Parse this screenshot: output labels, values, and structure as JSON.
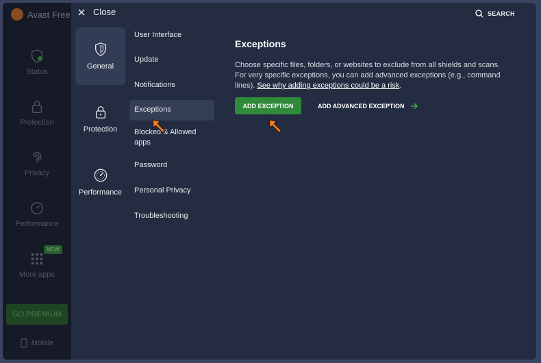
{
  "background_app": {
    "title": "Avast Free A",
    "nav": [
      {
        "label": "Status",
        "icon": "shield-check-icon"
      },
      {
        "label": "Protection",
        "icon": "lock-icon"
      },
      {
        "label": "Privacy",
        "icon": "fingerprint-icon"
      },
      {
        "label": "Performance",
        "icon": "speedometer-icon"
      },
      {
        "label": "More apps",
        "icon": "grid-icon",
        "badge": "NEW"
      }
    ],
    "premium_label": "GO PREMIUM",
    "mobile_label": "Mobile"
  },
  "header": {
    "close_label": "Close",
    "search_label": "SEARCH"
  },
  "categories": [
    {
      "label": "General",
      "icon": "shield-icon",
      "active": true
    },
    {
      "label": "Protection",
      "icon": "lock-icon",
      "active": false
    },
    {
      "label": "Performance",
      "icon": "speedometer-icon",
      "active": false
    }
  ],
  "subnav": [
    {
      "label": "User Interface"
    },
    {
      "label": "Update"
    },
    {
      "label": "Notifications"
    },
    {
      "label": "Exceptions",
      "active": true
    },
    {
      "label": "Blocked & Allowed apps"
    },
    {
      "label": "Password"
    },
    {
      "label": "Personal Privacy"
    },
    {
      "label": "Troubleshooting"
    }
  ],
  "content": {
    "title": "Exceptions",
    "description": "Choose specific files, folders, or websites to exclude from all shields and scans. For very specific exceptions, you can add advanced exceptions (e.g., command lines).",
    "link_text": "See why adding exceptions could be a risk",
    "link_suffix": ".",
    "add_button": "ADD EXCEPTION",
    "advanced_button": "ADD ADVANCED EXCEPTION"
  },
  "colors": {
    "accent_green": "#2f8a3a",
    "pointer_orange": "#f47c20"
  }
}
